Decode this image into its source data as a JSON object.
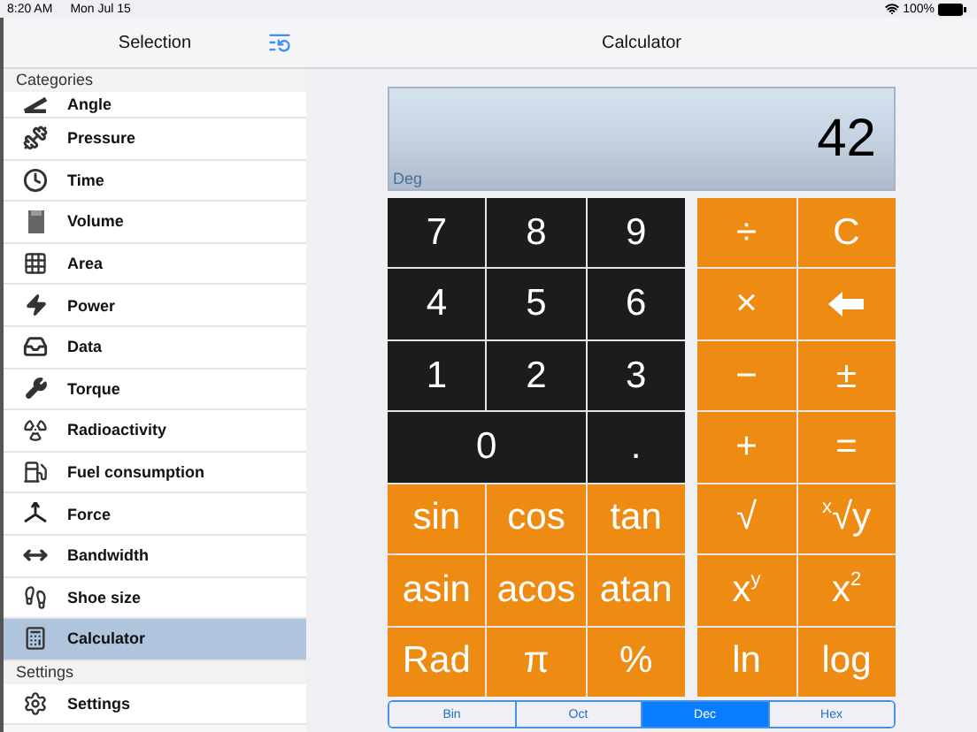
{
  "status_bar": {
    "time": "8:20 AM",
    "date": "Mon Jul 15",
    "battery": "100%"
  },
  "sidebar": {
    "title": "Selection",
    "sections": [
      {
        "header": "Categories",
        "items": [
          {
            "label": "Angle",
            "selected": false
          },
          {
            "label": "Pressure",
            "selected": false
          },
          {
            "label": "Time",
            "selected": false
          },
          {
            "label": "Volume",
            "selected": false
          },
          {
            "label": "Area",
            "selected": false
          },
          {
            "label": "Power",
            "selected": false
          },
          {
            "label": "Data",
            "selected": false
          },
          {
            "label": "Torque",
            "selected": false
          },
          {
            "label": "Radioactivity",
            "selected": false
          },
          {
            "label": "Fuel consumption",
            "selected": false
          },
          {
            "label": "Force",
            "selected": false
          },
          {
            "label": "Bandwidth",
            "selected": false
          },
          {
            "label": "Shoe size",
            "selected": false
          },
          {
            "label": "Calculator",
            "selected": true
          }
        ]
      },
      {
        "header": "Settings",
        "items": [
          {
            "label": "Settings",
            "selected": false
          }
        ]
      }
    ]
  },
  "main": {
    "title": "Calculator",
    "display": {
      "value": "42",
      "mode": "Deg"
    },
    "left_keys": [
      {
        "label": "7",
        "kind": "digit"
      },
      {
        "label": "8",
        "kind": "digit"
      },
      {
        "label": "9",
        "kind": "digit"
      },
      {
        "label": "4",
        "kind": "digit"
      },
      {
        "label": "5",
        "kind": "digit"
      },
      {
        "label": "6",
        "kind": "digit"
      },
      {
        "label": "1",
        "kind": "digit"
      },
      {
        "label": "2",
        "kind": "digit"
      },
      {
        "label": "3",
        "kind": "digit"
      },
      {
        "label": "0",
        "kind": "wide"
      },
      {
        "label": ".",
        "kind": "digit"
      },
      {
        "label": "sin",
        "kind": "func"
      },
      {
        "label": "cos",
        "kind": "func"
      },
      {
        "label": "tan",
        "kind": "func"
      },
      {
        "label": "asin",
        "kind": "func"
      },
      {
        "label": "acos",
        "kind": "func"
      },
      {
        "label": "atan",
        "kind": "func"
      },
      {
        "label": "Rad",
        "kind": "func"
      },
      {
        "label": "π",
        "kind": "func"
      },
      {
        "label": "%",
        "kind": "func"
      }
    ],
    "right_keys": [
      {
        "label": "÷",
        "kind": "func"
      },
      {
        "label": "C",
        "kind": "func"
      },
      {
        "label": "×",
        "kind": "func"
      },
      {
        "kind": "backspace"
      },
      {
        "label": "−",
        "kind": "func"
      },
      {
        "label": "±",
        "kind": "func"
      },
      {
        "label": "+",
        "kind": "func"
      },
      {
        "label": "=",
        "kind": "func"
      },
      {
        "label": "√",
        "kind": "func"
      },
      {
        "label": "$^{x}$√y",
        "kind": "func"
      },
      {
        "label": "x$^{y}$",
        "kind": "func"
      },
      {
        "label": "x$^{2}$",
        "kind": "func"
      },
      {
        "label": "ln",
        "kind": "func"
      },
      {
        "label": "log",
        "kind": "func"
      }
    ],
    "bases": [
      {
        "label": "Bin",
        "selected": false
      },
      {
        "label": "Oct",
        "selected": false
      },
      {
        "label": "Dec",
        "selected": true
      },
      {
        "label": "Hex",
        "selected": false
      }
    ]
  }
}
